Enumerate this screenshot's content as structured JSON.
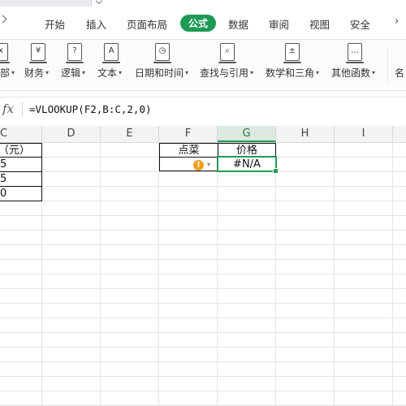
{
  "menu": {
    "tabs": [
      "开始",
      "插入",
      "页面布局",
      "公式",
      "数据",
      "审阅",
      "视图",
      "安全"
    ],
    "active": "公式"
  },
  "ribbon": {
    "left_partial_label": "部",
    "groups": [
      {
        "label": "财务",
        "icon": "¥"
      },
      {
        "label": "逻辑",
        "icon": "?"
      },
      {
        "label": "文本",
        "icon": "A"
      },
      {
        "label": "日期和时间",
        "icon": "◷"
      },
      {
        "label": "查找与引用",
        "icon": "⌕"
      },
      {
        "label": "数学和三角",
        "icon": "±"
      },
      {
        "label": "其他函数",
        "icon": "…"
      }
    ],
    "right_partial_label": "名"
  },
  "formula_bar": {
    "fx": "fx",
    "formula": "=VLOOKUP(F2,B:C,2,0)"
  },
  "columns": [
    "C",
    "D",
    "E",
    "F",
    "G",
    "H",
    "I"
  ],
  "selected_column": "G",
  "sheet": {
    "c_header": "（元）",
    "c_values": [
      "5",
      "5",
      "0"
    ],
    "f1": "点菜",
    "g1": "价格",
    "g2": "#N/A"
  },
  "colors": {
    "accent": "#1f9a55",
    "warning": "#f0a020"
  }
}
